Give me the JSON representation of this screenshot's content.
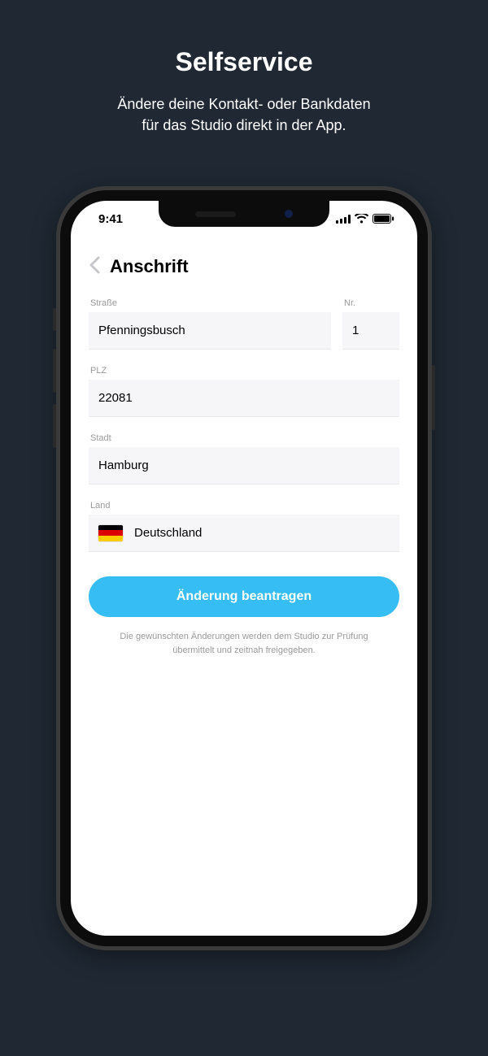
{
  "promo": {
    "title": "Selfservice",
    "subtitle_line1": "Ändere deine Kontakt- oder Bankdaten",
    "subtitle_line2": "für das Studio direkt in der App."
  },
  "status_bar": {
    "time": "9:41"
  },
  "header": {
    "title": "Anschrift"
  },
  "form": {
    "street": {
      "label": "Straße",
      "value": "Pfenningsbusch"
    },
    "number": {
      "label": "Nr.",
      "value": "1"
    },
    "zip": {
      "label": "PLZ",
      "value": "22081"
    },
    "city": {
      "label": "Stadt",
      "value": "Hamburg"
    },
    "country": {
      "label": "Land",
      "value": "Deutschland"
    },
    "submit_label": "Änderung beantragen",
    "help_line1": "Die gewünschten Änderungen werden dem Studio zur Prüfung",
    "help_line2": "übermittelt und zeitnah freigegeben."
  }
}
